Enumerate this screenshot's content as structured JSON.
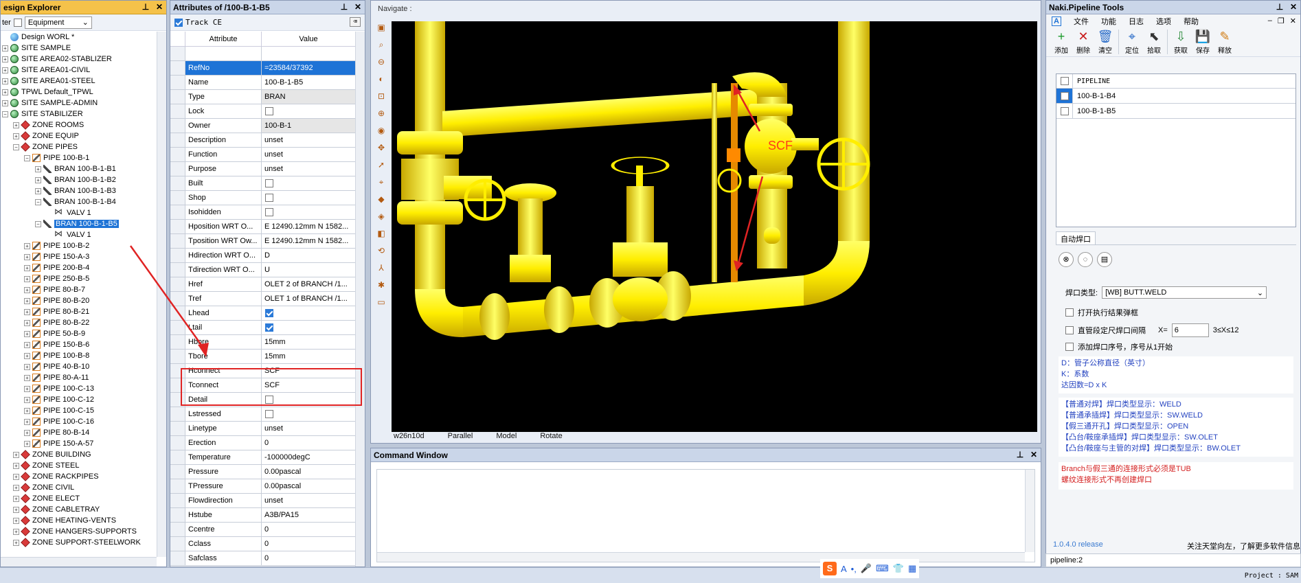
{
  "explorer": {
    "title": "esign Explorer",
    "filter_label": "ter",
    "filter_value": "Equipment",
    "tree": [
      {
        "label": "Design WORL *",
        "depth": 0,
        "icon": "world",
        "exp": ""
      },
      {
        "label": "SITE SAMPLE",
        "depth": 0,
        "icon": "site",
        "exp": "+"
      },
      {
        "label": "SITE AREA02-STABLIZER",
        "depth": 0,
        "icon": "site",
        "exp": "+"
      },
      {
        "label": "SITE AREA01-CIVIL",
        "depth": 0,
        "icon": "site",
        "exp": "+"
      },
      {
        "label": "SITE AREA01-STEEL",
        "depth": 0,
        "icon": "site",
        "exp": "+"
      },
      {
        "label": "TPWL Default_TPWL",
        "depth": 0,
        "icon": "site",
        "exp": "+"
      },
      {
        "label": "SITE SAMPLE-ADMIN",
        "depth": 0,
        "icon": "site",
        "exp": "+"
      },
      {
        "label": "SITE STABILIZER",
        "depth": 0,
        "icon": "site",
        "exp": "−"
      },
      {
        "label": "ZONE ROOMS",
        "depth": 1,
        "icon": "zone",
        "exp": "+"
      },
      {
        "label": "ZONE EQUIP",
        "depth": 1,
        "icon": "zone",
        "exp": "+"
      },
      {
        "label": "ZONE PIPES",
        "depth": 1,
        "icon": "zone",
        "exp": "−"
      },
      {
        "label": "PIPE 100-B-1",
        "depth": 2,
        "icon": "pipe",
        "exp": "−"
      },
      {
        "label": "BRAN 100-B-1-B1",
        "depth": 3,
        "icon": "bran",
        "exp": "+"
      },
      {
        "label": "BRAN 100-B-1-B2",
        "depth": 3,
        "icon": "bran",
        "exp": "+"
      },
      {
        "label": "BRAN 100-B-1-B3",
        "depth": 3,
        "icon": "bran",
        "exp": "+"
      },
      {
        "label": "BRAN 100-B-1-B4",
        "depth": 3,
        "icon": "bran",
        "exp": "−"
      },
      {
        "label": "VALV 1",
        "depth": 4,
        "icon": "valv",
        "exp": ""
      },
      {
        "label": "BRAN 100-B-1-B5",
        "depth": 3,
        "icon": "bran",
        "exp": "−",
        "selected": true
      },
      {
        "label": "VALV 1",
        "depth": 4,
        "icon": "valv",
        "exp": ""
      },
      {
        "label": "PIPE 100-B-2",
        "depth": 2,
        "icon": "pipe",
        "exp": "+"
      },
      {
        "label": "PIPE 150-A-3",
        "depth": 2,
        "icon": "pipe",
        "exp": "+"
      },
      {
        "label": "PIPE 200-B-4",
        "depth": 2,
        "icon": "pipe",
        "exp": "+"
      },
      {
        "label": "PIPE 250-B-5",
        "depth": 2,
        "icon": "pipe",
        "exp": "+"
      },
      {
        "label": "PIPE 80-B-7",
        "depth": 2,
        "icon": "pipe",
        "exp": "+"
      },
      {
        "label": "PIPE 80-B-20",
        "depth": 2,
        "icon": "pipe",
        "exp": "+"
      },
      {
        "label": "PIPE 80-B-21",
        "depth": 2,
        "icon": "pipe",
        "exp": "+"
      },
      {
        "label": "PIPE 80-B-22",
        "depth": 2,
        "icon": "pipe",
        "exp": "+"
      },
      {
        "label": "PIPE 50-B-9",
        "depth": 2,
        "icon": "pipe",
        "exp": "+"
      },
      {
        "label": "PIPE 150-B-6",
        "depth": 2,
        "icon": "pipe",
        "exp": "+"
      },
      {
        "label": "PIPE 100-B-8",
        "depth": 2,
        "icon": "pipe",
        "exp": "+"
      },
      {
        "label": "PIPE 40-B-10",
        "depth": 2,
        "icon": "pipe",
        "exp": "+"
      },
      {
        "label": "PIPE 80-A-11",
        "depth": 2,
        "icon": "pipe",
        "exp": "+"
      },
      {
        "label": "PIPE 100-C-13",
        "depth": 2,
        "icon": "pipe",
        "exp": "+"
      },
      {
        "label": "PIPE 100-C-12",
        "depth": 2,
        "icon": "pipe",
        "exp": "+"
      },
      {
        "label": "PIPE 100-C-15",
        "depth": 2,
        "icon": "pipe",
        "exp": "+"
      },
      {
        "label": "PIPE 100-C-16",
        "depth": 2,
        "icon": "pipe",
        "exp": "+"
      },
      {
        "label": "PIPE 80-B-14",
        "depth": 2,
        "icon": "pipe",
        "exp": "+"
      },
      {
        "label": "PIPE 150-A-57",
        "depth": 2,
        "icon": "pipe",
        "exp": "+"
      },
      {
        "label": "ZONE BUILDING",
        "depth": 1,
        "icon": "zone",
        "exp": "+"
      },
      {
        "label": "ZONE STEEL",
        "depth": 1,
        "icon": "zone",
        "exp": "+"
      },
      {
        "label": "ZONE RACKPIPES",
        "depth": 1,
        "icon": "zone",
        "exp": "+"
      },
      {
        "label": "ZONE CIVIL",
        "depth": 1,
        "icon": "zone",
        "exp": "+"
      },
      {
        "label": "ZONE ELECT",
        "depth": 1,
        "icon": "zone",
        "exp": "+"
      },
      {
        "label": "ZONE CABLETRAY",
        "depth": 1,
        "icon": "zone",
        "exp": "+"
      },
      {
        "label": "ZONE HEATING-VENTS",
        "depth": 1,
        "icon": "zone",
        "exp": "+"
      },
      {
        "label": "ZONE HANGERS-SUPPORTS",
        "depth": 1,
        "icon": "zone",
        "exp": "+"
      },
      {
        "label": "ZONE SUPPORT-STEELWORK",
        "depth": 1,
        "icon": "zone",
        "exp": "+"
      }
    ]
  },
  "attributes": {
    "title": "Attributes of /100-B-1-B5",
    "track_label": "Track CE",
    "col_attr": "Attribute",
    "col_value": "Value",
    "rows": [
      {
        "k": "",
        "v": "",
        "t": "blank"
      },
      {
        "k": "RefNo",
        "v": "=23584/37392",
        "t": "sel"
      },
      {
        "k": "Name",
        "v": "100-B-1-B5",
        "t": "text"
      },
      {
        "k": "Type",
        "v": "BRAN",
        "t": "ro"
      },
      {
        "k": "Lock",
        "v": "",
        "t": "chk"
      },
      {
        "k": "Owner",
        "v": "100-B-1",
        "t": "ro"
      },
      {
        "k": "Description",
        "v": "unset",
        "t": "text"
      },
      {
        "k": "Function",
        "v": "unset",
        "t": "text"
      },
      {
        "k": "Purpose",
        "v": "unset",
        "t": "text"
      },
      {
        "k": "Built",
        "v": "",
        "t": "chk"
      },
      {
        "k": "Shop",
        "v": "",
        "t": "chk"
      },
      {
        "k": "Isohidden",
        "v": "",
        "t": "chk"
      },
      {
        "k": "Hposition WRT O...",
        "v": "E 12490.12mm N 1582...",
        "t": "text"
      },
      {
        "k": "Tposition WRT Ow...",
        "v": "E 12490.12mm N 1582...",
        "t": "text"
      },
      {
        "k": "Hdirection WRT O...",
        "v": "D",
        "t": "text"
      },
      {
        "k": "Tdirection WRT O...",
        "v": "U",
        "t": "text"
      },
      {
        "k": "Href",
        "v": "OLET 2 of BRANCH /1...",
        "t": "text"
      },
      {
        "k": "Tref",
        "v": "OLET 1 of BRANCH /1...",
        "t": "text"
      },
      {
        "k": "Lhead",
        "v": "",
        "t": "chkon"
      },
      {
        "k": "Ltail",
        "v": "",
        "t": "chkon"
      },
      {
        "k": "Hbore",
        "v": "15mm",
        "t": "text"
      },
      {
        "k": "Tbore",
        "v": "15mm",
        "t": "text"
      },
      {
        "k": "Hconnect",
        "v": "SCF",
        "t": "text"
      },
      {
        "k": "Tconnect",
        "v": "SCF",
        "t": "text"
      },
      {
        "k": "Detail",
        "v": "",
        "t": "chk"
      },
      {
        "k": "Lstressed",
        "v": "",
        "t": "chk"
      },
      {
        "k": "Linetype",
        "v": "unset",
        "t": "text"
      },
      {
        "k": "Erection",
        "v": "0",
        "t": "text"
      },
      {
        "k": "Temperature",
        "v": "-100000degC",
        "t": "text"
      },
      {
        "k": "Pressure",
        "v": "0.00pascal",
        "t": "text"
      },
      {
        "k": "TPressure",
        "v": "0.00pascal",
        "t": "text"
      },
      {
        "k": "Flowdirection",
        "v": "unset",
        "t": "text"
      },
      {
        "k": "Hstube",
        "v": "A3B/PA15",
        "t": "text"
      },
      {
        "k": "Ccentre",
        "v": "0",
        "t": "text"
      },
      {
        "k": "Cclass",
        "v": "0",
        "t": "text"
      },
      {
        "k": "Safclass",
        "v": "0",
        "t": "text"
      }
    ]
  },
  "navigate": {
    "label": "Navigate :",
    "scf_label": "SCF",
    "status": [
      "w26n10d",
      "Parallel",
      "Model",
      "Rotate"
    ]
  },
  "command": {
    "title": "Command Window"
  },
  "naki": {
    "title": "Naki.Pipeline Tools",
    "menu": [
      "文件",
      "功能",
      "日志",
      "选项",
      "帮助"
    ],
    "tools": [
      {
        "label": "添加",
        "icon": "+",
        "color": "#1a9a2a"
      },
      {
        "label": "删除",
        "icon": "✕",
        "color": "#c81c1c"
      },
      {
        "label": "清空",
        "icon": "🗑",
        "color": "#2a6cc8"
      },
      {
        "label": "定位",
        "icon": "⌖",
        "color": "#2a6cc8"
      },
      {
        "label": "拾取",
        "icon": "⬉",
        "color": "#333333"
      },
      {
        "label": "获取",
        "icon": "⇩",
        "color": "#2a8a3a"
      },
      {
        "label": "保存",
        "icon": "💾",
        "color": "#333333"
      },
      {
        "label": "释放",
        "icon": "✎",
        "color": "#d07a10"
      }
    ],
    "list_header": "PIPELINE",
    "list": [
      {
        "name": "100-B-1-B4",
        "selected": true
      },
      {
        "name": "100-B-1-B5",
        "selected": false
      }
    ],
    "tab_label": "自动焊口",
    "weld_type_label": "焊口类型:",
    "weld_type_value": "[WB] BUTT.WELD",
    "opt1": "打开执行结果弹框",
    "opt2": "直管段定尺焊口间隔",
    "x_label": "X=",
    "x_value": "6",
    "x_range": "3≤X≤12",
    "opt3": "添加焊口序号，序号从1开始",
    "info1": [
      "D：管子公称直径（英寸）",
      "K：系数",
      "达因数=D x K"
    ],
    "info2": [
      "【普通对焊】焊口类型显示：WELD",
      "【普通承插焊】焊口类型显示：SW.WELD",
      "【假三通开孔】焊口类型显示：OPEN",
      "【凸台/鞍座承插焊】焊口类型显示：SW.OLET",
      "【凸台/鞍座与主管的对焊】焊口类型显示：BW.OLET"
    ],
    "warn": [
      "Branch与假三通的连接形式必须是TUB",
      "螺纹连接形式不再创建焊口"
    ],
    "version": "1.0.4.0 release",
    "follow": "关注天堂向左，了解更多软件信息",
    "status_line": "pipeline:2"
  },
  "statusbar": {
    "project": "Project : SAM"
  },
  "colors": {
    "pipe_yellow": "#ffee00",
    "select_blue": "#1e73d6",
    "annot_red": "#e02323"
  }
}
